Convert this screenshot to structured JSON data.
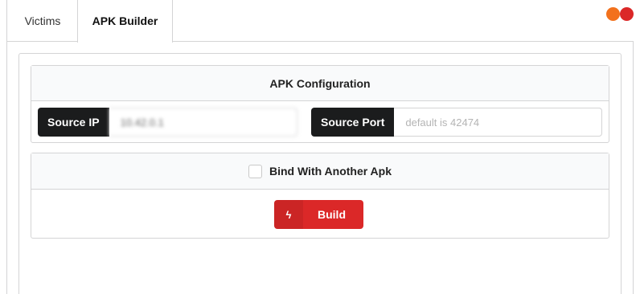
{
  "tabs": [
    {
      "label": "Victims",
      "active": false
    },
    {
      "label": "APK Builder",
      "active": true
    }
  ],
  "window_dots": [
    {
      "name": "orange-dot",
      "color": "#f2711c"
    },
    {
      "name": "red-dot",
      "color": "#db2828"
    }
  ],
  "config": {
    "header": "APK Configuration",
    "source_ip": {
      "label": "Source IP",
      "value": "10.42.0.1",
      "placeholder": ""
    },
    "source_port": {
      "label": "Source Port",
      "value": "",
      "placeholder": "default is 42474"
    }
  },
  "bind": {
    "label": "Bind With Another Apk",
    "checked": false
  },
  "build_button": {
    "label": "Build",
    "icon": "lightning-icon",
    "icon_glyph": "ϟ"
  },
  "colors": {
    "label_bg": "#1b1c1d",
    "build_bg": "#db2828",
    "accent_orange": "#f2711c",
    "accent_red": "#db2828"
  }
}
